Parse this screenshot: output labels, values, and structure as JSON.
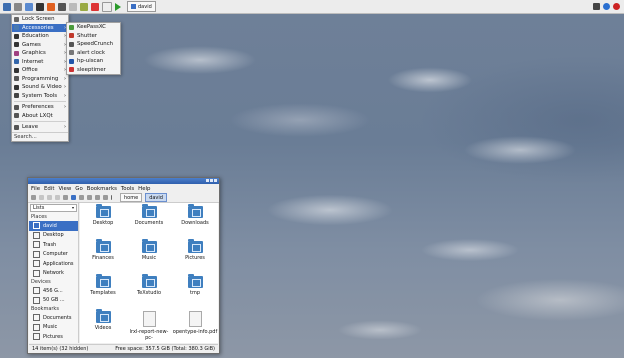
{
  "taskbar": {
    "window_label": "david"
  },
  "start_menu": {
    "items": [
      {
        "label": "Lock Screen",
        "icon": "lock-icon",
        "color": "#666666",
        "arrow": false
      },
      {
        "label": "Accessories",
        "icon": "accessories-icon",
        "color": "#4a7ab0",
        "arrow": true,
        "selected": true
      },
      {
        "label": "Education",
        "icon": "education-icon",
        "color": "#333333",
        "arrow": true
      },
      {
        "label": "Games",
        "icon": "games-icon",
        "color": "#333333",
        "arrow": true
      },
      {
        "label": "Graphics",
        "icon": "graphics-icon",
        "color": "#a04080",
        "arrow": true
      },
      {
        "label": "Internet",
        "icon": "internet-icon",
        "color": "#3366aa",
        "arrow": true
      },
      {
        "label": "Office",
        "icon": "office-icon",
        "color": "#333333",
        "arrow": true
      },
      {
        "label": "Programming",
        "icon": "programming-icon",
        "color": "#555555",
        "arrow": true
      },
      {
        "label": "Sound & Video",
        "icon": "sound-video-icon",
        "color": "#333333",
        "arrow": true
      },
      {
        "label": "System Tools",
        "icon": "system-tools-icon",
        "color": "#444444",
        "arrow": true
      },
      {
        "label": "Preferences",
        "icon": "preferences-icon",
        "color": "#555555",
        "arrow": true
      },
      {
        "label": "About LXQt",
        "icon": "about-icon",
        "color": "#555555",
        "arrow": false
      },
      {
        "label": "Leave",
        "icon": "leave-icon",
        "color": "#555555",
        "arrow": true
      }
    ],
    "search_label": "Search..."
  },
  "submenu": {
    "items": [
      {
        "label": "KeePassXC",
        "icon": "keepassxc-icon",
        "color": "#4a9a3a"
      },
      {
        "label": "Shutter",
        "icon": "shutter-icon",
        "color": "#c0392b"
      },
      {
        "label": "SpeedCrunch",
        "icon": "speedcrunch-icon",
        "color": "#555555"
      },
      {
        "label": "alert clock",
        "icon": "alarm-clock-icon",
        "color": "#777777"
      },
      {
        "label": "hp-uiscan",
        "icon": "hp-scan-icon",
        "color": "#2255aa"
      },
      {
        "label": "sleeptimer",
        "icon": "sleeptimer-icon",
        "color": "#cc3333"
      }
    ]
  },
  "file_manager": {
    "menubar": [
      "File",
      "Edit",
      "View",
      "Go",
      "Bookmarks",
      "Tools",
      "Help"
    ],
    "breadcrumbs": [
      "home",
      "david"
    ],
    "side_mode": "Lists",
    "places_header": "Places",
    "places": [
      {
        "label": "david",
        "selected": true
      },
      {
        "label": "Desktop"
      },
      {
        "label": "Trash"
      },
      {
        "label": "Computer"
      },
      {
        "label": "Applications"
      },
      {
        "label": "Network"
      }
    ],
    "devices_header": "Devices",
    "devices": [
      {
        "label": "456 G..."
      },
      {
        "label": "50 GB ..."
      }
    ],
    "bookmarks_header": "Bookmarks",
    "bookmarks": [
      {
        "label": "Documents"
      },
      {
        "label": "Music"
      },
      {
        "label": "Pictures"
      }
    ],
    "files": [
      {
        "label": "Desktop",
        "kind": "folder"
      },
      {
        "label": "Documents",
        "kind": "folder"
      },
      {
        "label": "Downloads",
        "kind": "folder"
      },
      {
        "label": "Finances",
        "kind": "folder"
      },
      {
        "label": "Music",
        "kind": "folder"
      },
      {
        "label": "Pictures",
        "kind": "folder"
      },
      {
        "label": "Templates",
        "kind": "folder"
      },
      {
        "label": "TeXstudio",
        "kind": "folder"
      },
      {
        "label": "tmp",
        "kind": "folder"
      },
      {
        "label": "Videos",
        "kind": "folder"
      },
      {
        "label": "lrxl-report-new-pc-",
        "kind": "file"
      },
      {
        "label": "opentype-info.pdf",
        "kind": "file"
      }
    ],
    "status_left": "14 item(s) (32 hidden)",
    "status_right": "Free space: 357.5 GiB (Total: 380.3 GiB)"
  }
}
